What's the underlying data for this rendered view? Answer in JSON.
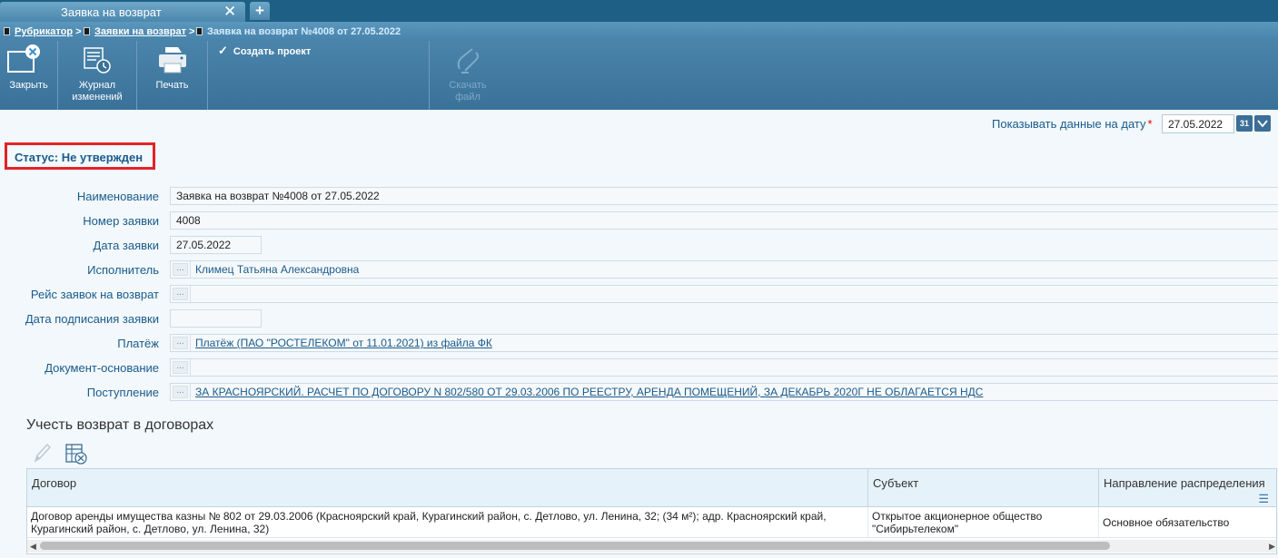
{
  "tab": {
    "title": "Заявка на возврат",
    "close_symbol": "✕",
    "add_symbol": "+"
  },
  "breadcrumb": {
    "items": [
      "Рубрикатор",
      "Заявки на возврат"
    ],
    "separator": ">",
    "current": "Заявка на возврат №4008 от 27.05.2022"
  },
  "toolbar": {
    "close_label": "Закрыть",
    "journal_label_1": "Журнал",
    "journal_label_2": "изменений",
    "print_label": "Печать",
    "create_project_label": "Создать проект",
    "download_label_1": "Скачать",
    "download_label_2": "файл"
  },
  "date_filter": {
    "label": "Показывать данные на дату",
    "required_mark": "*",
    "value": "27.05.2022",
    "calendar_text": "31"
  },
  "status": {
    "text": "Статус: Не утвержден"
  },
  "form": {
    "name_label": "Наименование",
    "name_value": "Заявка на возврат №4008 от 27.05.2022",
    "number_label": "Номер заявки",
    "number_value": "4008",
    "date_label": "Дата заявки",
    "date_value": "27.05.2022",
    "executor_label": "Исполнитель",
    "executor_value": "Климец Татьяна Александровна",
    "trip_label": "Рейс заявок на возврат",
    "trip_value": "",
    "sign_date_label": "Дата подписания заявки",
    "sign_date_value": "",
    "payment_label": "Платёж",
    "payment_value": "Платёж (ПАО \"РОСТЕЛЕКОМ\" от 11.01.2021) из файла ФК",
    "basis_label": "Документ-основание",
    "basis_value": "",
    "receipt_label": "Поступление",
    "receipt_value": "ЗА КРАСНОЯРСКИЙ. РАСЧЕТ ПО ДОГОВОРУ N 802/580 ОТ 29.03.2006 ПО РЕЕСТРУ, АРЕНДА ПОМЕЩЕНИЙ, ЗА ДЕКАБРЬ 2020Г НЕ ОБЛАГАЕТСЯ НДС",
    "dots": "..."
  },
  "section": {
    "title": "Учесть возврат в договорах"
  },
  "table": {
    "columns": [
      "Договор",
      "Субъект",
      "Направление распределения"
    ],
    "rows": [
      {
        "contract": "Договор аренды имущества казны № 802 от 29.03.2006 (Красноярский край, Курагинский район, с. Детлово, ул. Ленина, 32; (34 м²); адр. Красноярский край, Курагинский район, с. Детлово, ул. Ленина, 32)",
        "subject": "Открытое акционерное общество \"Сибирьтелеком\"",
        "direction": "Основное обязательство"
      }
    ]
  }
}
